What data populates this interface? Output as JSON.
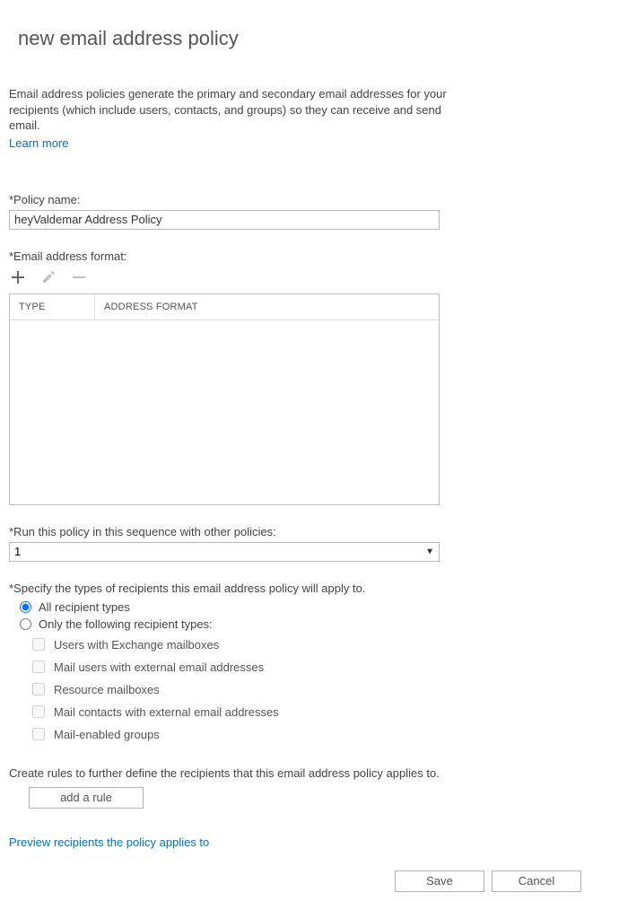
{
  "title": "new email address policy",
  "intro": "Email address policies generate the primary and secondary email addresses for your recipients (which include users, contacts, and groups) so they can receive and send email.",
  "learn_more": "Learn more",
  "policy_name": {
    "label": "*Policy name:",
    "value": "heyValdemar Address Policy"
  },
  "format": {
    "label": "*Email address format:",
    "headers": {
      "type": "TYPE",
      "format": "ADDRESS FORMAT"
    }
  },
  "sequence": {
    "label": "*Run this policy in this sequence with other policies:",
    "value": "1"
  },
  "specify": {
    "label": "*Specify the types of recipients this email address policy will apply to.",
    "options": {
      "all": "All recipient types",
      "only": "Only the following recipient types:"
    },
    "checks": {
      "users_exchange": "Users with Exchange mailboxes",
      "mail_users": "Mail users with external email addresses",
      "resource": "Resource mailboxes",
      "mail_contacts": "Mail contacts with external email addresses",
      "mail_groups": "Mail-enabled groups"
    }
  },
  "create_rules": "Create rules to further define the recipients that this email address policy applies to.",
  "add_rule": "add a rule",
  "preview": "Preview recipients the policy applies to",
  "buttons": {
    "save": "Save",
    "cancel": "Cancel"
  }
}
